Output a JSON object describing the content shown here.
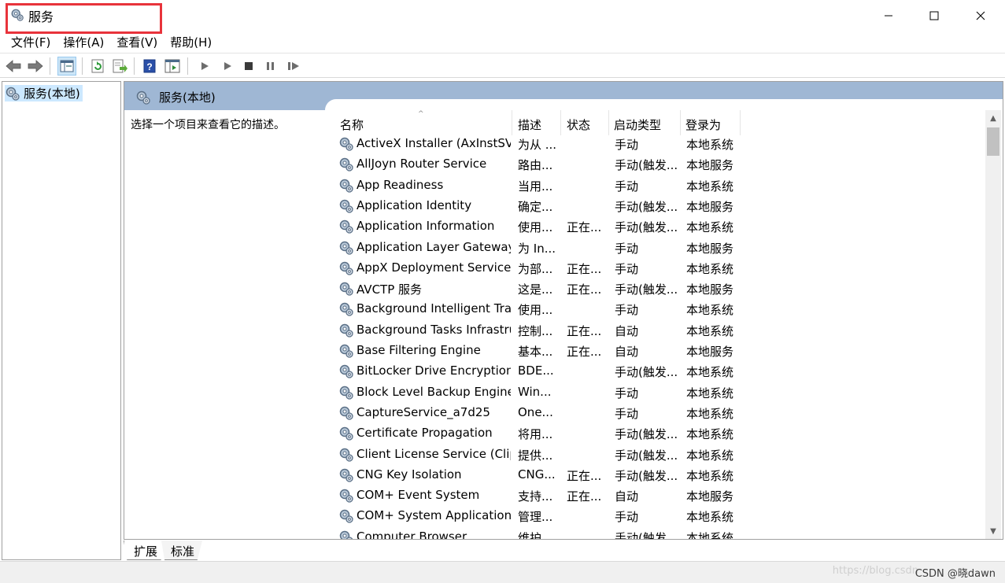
{
  "window": {
    "title": "服务",
    "controls": {
      "minimize": "minimize",
      "maximize": "maximize",
      "close": "close"
    }
  },
  "menu": [
    "文件(F)",
    "操作(A)",
    "查看(V)",
    "帮助(H)"
  ],
  "toolbar": {
    "icons": [
      "back-arrow-icon",
      "forward-arrow-icon",
      "show-hide-console-tree-icon",
      "refresh-icon",
      "export-list-icon",
      "help-icon",
      "properties-panel-icon",
      "start-service-icon",
      "start-service-params-icon",
      "stop-service-icon",
      "pause-service-icon",
      "resume-service-icon"
    ]
  },
  "tree": {
    "root_label": "服务(本地)"
  },
  "content": {
    "header_title": "服务(本地)",
    "description_hint": "选择一个项目来查看它的描述。",
    "columns": [
      "名称",
      "描述",
      "状态",
      "启动类型",
      "登录为"
    ],
    "services": [
      {
        "name": "ActiveX Installer (AxInstSV)",
        "desc": "为从 ...",
        "status": "",
        "startup": "手动",
        "logon": "本地系统"
      },
      {
        "name": "AllJoyn Router Service",
        "desc": "路由...",
        "status": "",
        "startup": "手动(触发...",
        "logon": "本地服务"
      },
      {
        "name": "App Readiness",
        "desc": "当用...",
        "status": "",
        "startup": "手动",
        "logon": "本地系统"
      },
      {
        "name": "Application Identity",
        "desc": "确定...",
        "status": "",
        "startup": "手动(触发...",
        "logon": "本地服务"
      },
      {
        "name": "Application Information",
        "desc": "使用...",
        "status": "正在...",
        "startup": "手动(触发...",
        "logon": "本地系统"
      },
      {
        "name": "Application Layer Gateway ...",
        "desc": "为 In...",
        "status": "",
        "startup": "手动",
        "logon": "本地服务"
      },
      {
        "name": "AppX Deployment Service ...",
        "desc": "为部...",
        "status": "正在...",
        "startup": "手动",
        "logon": "本地系统"
      },
      {
        "name": "AVCTP 服务",
        "desc": "这是...",
        "status": "正在...",
        "startup": "手动(触发...",
        "logon": "本地服务"
      },
      {
        "name": "Background Intelligent Tra...",
        "desc": "使用...",
        "status": "",
        "startup": "手动",
        "logon": "本地系统"
      },
      {
        "name": "Background Tasks Infrastru...",
        "desc": "控制...",
        "status": "正在...",
        "startup": "自动",
        "logon": "本地系统"
      },
      {
        "name": "Base Filtering Engine",
        "desc": "基本...",
        "status": "正在...",
        "startup": "自动",
        "logon": "本地服务"
      },
      {
        "name": "BitLocker Drive Encryption ...",
        "desc": "BDE...",
        "status": "",
        "startup": "手动(触发...",
        "logon": "本地系统"
      },
      {
        "name": "Block Level Backup Engine ...",
        "desc": "Win...",
        "status": "",
        "startup": "手动",
        "logon": "本地系统"
      },
      {
        "name": "CaptureService_a7d25",
        "desc": "One...",
        "status": "",
        "startup": "手动",
        "logon": "本地系统"
      },
      {
        "name": "Certificate Propagation",
        "desc": "将用...",
        "status": "",
        "startup": "手动(触发...",
        "logon": "本地系统"
      },
      {
        "name": "Client License Service (Clip...",
        "desc": "提供...",
        "status": "",
        "startup": "手动(触发...",
        "logon": "本地系统"
      },
      {
        "name": "CNG Key Isolation",
        "desc": "CNG...",
        "status": "正在...",
        "startup": "手动(触发...",
        "logon": "本地系统"
      },
      {
        "name": "COM+ Event System",
        "desc": "支持...",
        "status": "正在...",
        "startup": "自动",
        "logon": "本地服务"
      },
      {
        "name": "COM+ System Application",
        "desc": "管理...",
        "status": "",
        "startup": "手动",
        "logon": "本地系统"
      },
      {
        "name": "Computer Browser",
        "desc": "维护...",
        "status": "",
        "startup": "手动(触发...",
        "logon": "本地系统"
      }
    ]
  },
  "bottom_tabs": [
    "扩展",
    "标准"
  ],
  "statusbar": {
    "watermark": "CSDN @晓dawn",
    "faded_watermark": "https://blog.csdn"
  },
  "colors": {
    "highlight_border": "#e8333b",
    "header_band": "#9fb7d4",
    "selection": "#cce8ff"
  }
}
